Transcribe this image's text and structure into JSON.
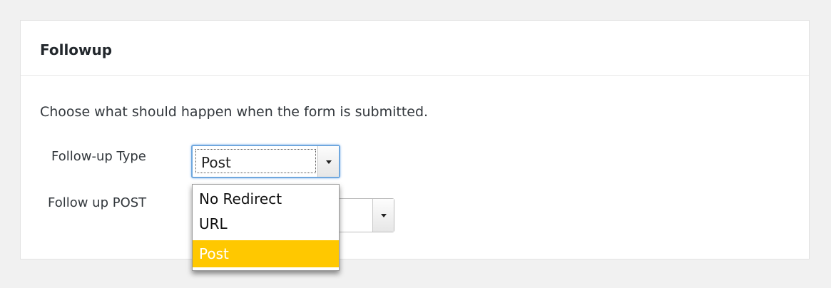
{
  "panel": {
    "title": "Followup",
    "intro": "Choose what should happen when the form is submitted."
  },
  "fields": {
    "type_label": "Follow-up Type",
    "type_value": "Post",
    "post_label": "Follow up POST"
  },
  "dropdown": {
    "options": [
      "No Redirect",
      "URL",
      "Post"
    ],
    "selected": "Post",
    "highlight_color": "#ffc800"
  },
  "colors": {
    "background": "#f1f1f1",
    "focus_border": "#6fa7de"
  },
  "icons": {
    "select_arrow": "chevron-down-icon"
  }
}
